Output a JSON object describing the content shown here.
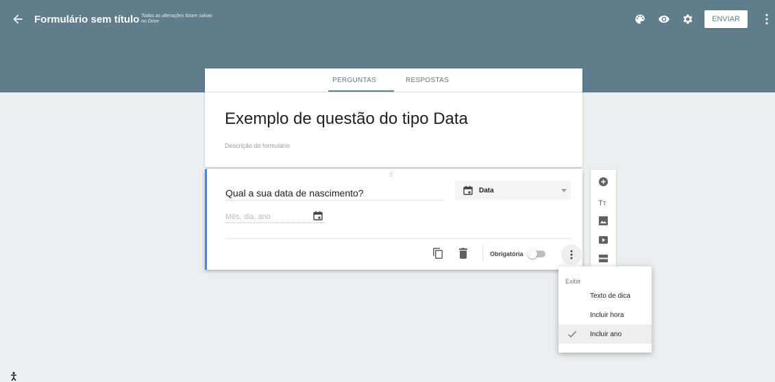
{
  "header": {
    "title": "Formulário sem título",
    "save_status": "Todas as alterações foram salvas no Drive",
    "send_label": "ENVIAR",
    "icons": [
      "arrow-back-icon",
      "palette-icon",
      "eye-icon",
      "gear-icon",
      "more-vert-icon"
    ]
  },
  "tabs": [
    {
      "label": "PERGUNTAS",
      "active": true
    },
    {
      "label": "RESPOSTAS",
      "active": false
    }
  ],
  "form": {
    "title": "Exemplo de questão do tipo Data",
    "description_placeholder": "Descrição do formulário"
  },
  "question": {
    "title": "Qual a sua data de nascimento?",
    "type_label": "Data",
    "date_placeholder": "Mês, dia, ano",
    "required_label": "Obrigatória",
    "required": false
  },
  "sidebar": {
    "icons": [
      "add-circle-icon",
      "title-icon",
      "image-icon",
      "video-icon",
      "section-icon"
    ]
  },
  "menu": {
    "header": "Exibir",
    "items": [
      {
        "label": "Texto de dica",
        "checked": false
      },
      {
        "label": "Incluir hora",
        "checked": false
      },
      {
        "label": "Incluir ano",
        "checked": true
      }
    ]
  },
  "colors": {
    "header_bg": "#607d8b",
    "page_bg": "#eceff1",
    "accent_left_border": "#4285f4"
  }
}
